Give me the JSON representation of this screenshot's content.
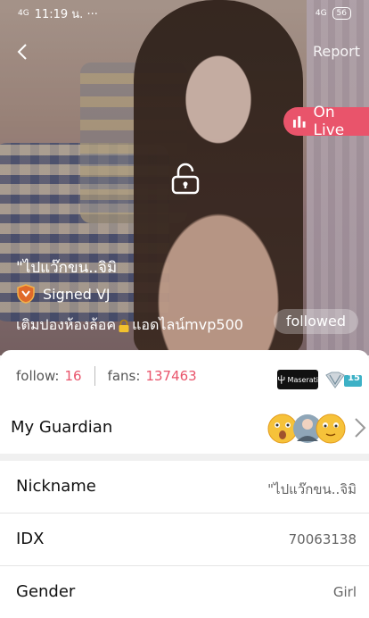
{
  "status_bar": {
    "signal_left": "4G",
    "time": "11:19 น. ···",
    "signal_right": "4G",
    "battery": "56"
  },
  "header": {
    "report_label": "Report",
    "live_label": "On Live"
  },
  "profile": {
    "headline_name": "\"ไปแว๊กขน..จิมิ",
    "signed_label": "Signed VJ",
    "description_before": "เติมปองห้องล้อค",
    "description_after": "แอดไลน์mvp500",
    "followed_label": "followed"
  },
  "stats": {
    "follow_label": "follow:",
    "follow_count": "16",
    "fans_label": "fans:",
    "fans_count": "137463",
    "badge_text": "Maserati",
    "level_badge": "15"
  },
  "guardian": {
    "label": "My Guardian"
  },
  "details": [
    {
      "key": "Nickname",
      "value": "\"ไปแว๊กขน..จิมิ"
    },
    {
      "key": "IDX",
      "value": "70063138"
    },
    {
      "key": "Gender",
      "value": "Girl"
    }
  ],
  "colors": {
    "accent": "#e9546b",
    "live_bg": "#e9546b"
  }
}
